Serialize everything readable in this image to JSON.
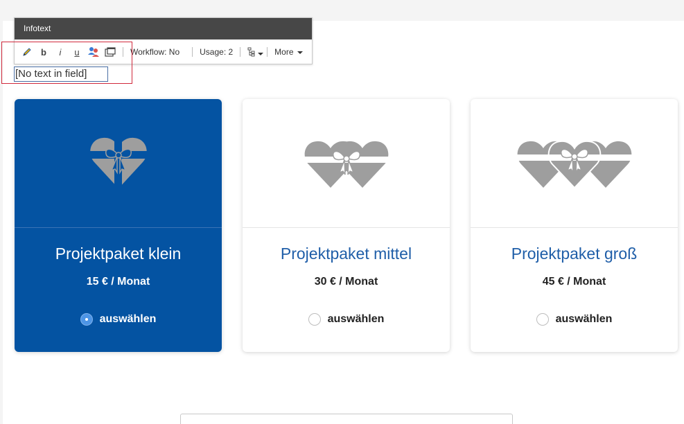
{
  "editor": {
    "title": "Infotext",
    "toolbar": {
      "icons": [
        "pencil-icon",
        "bold-icon",
        "italic-icon",
        "underline-icon",
        "users-icon",
        "window-icon",
        "tree-icon"
      ],
      "bold_label": "b",
      "italic_label": "i",
      "underline_label": "u",
      "workflow_label": "Workflow: No",
      "usage_label": "Usage: 2",
      "more_label": "More"
    },
    "field_text": "[No text in field]"
  },
  "packages": [
    {
      "title": "Projektpaket klein",
      "price": "15 € / Monat",
      "select_label": "auswählen",
      "selected": true,
      "hearts": 1
    },
    {
      "title": "Projektpaket mittel",
      "price": "30 € / Monat",
      "select_label": "auswählen",
      "selected": false,
      "hearts": 2
    },
    {
      "title": "Projektpaket groß",
      "price": "45 € / Monat",
      "select_label": "auswählen",
      "selected": false,
      "hearts": 3
    }
  ],
  "colors": {
    "selected_card": "#0453a2",
    "heart_gray": "#9e9e9e",
    "title_blue": "#1f5ea8",
    "highlight_red": "#d0283b"
  }
}
